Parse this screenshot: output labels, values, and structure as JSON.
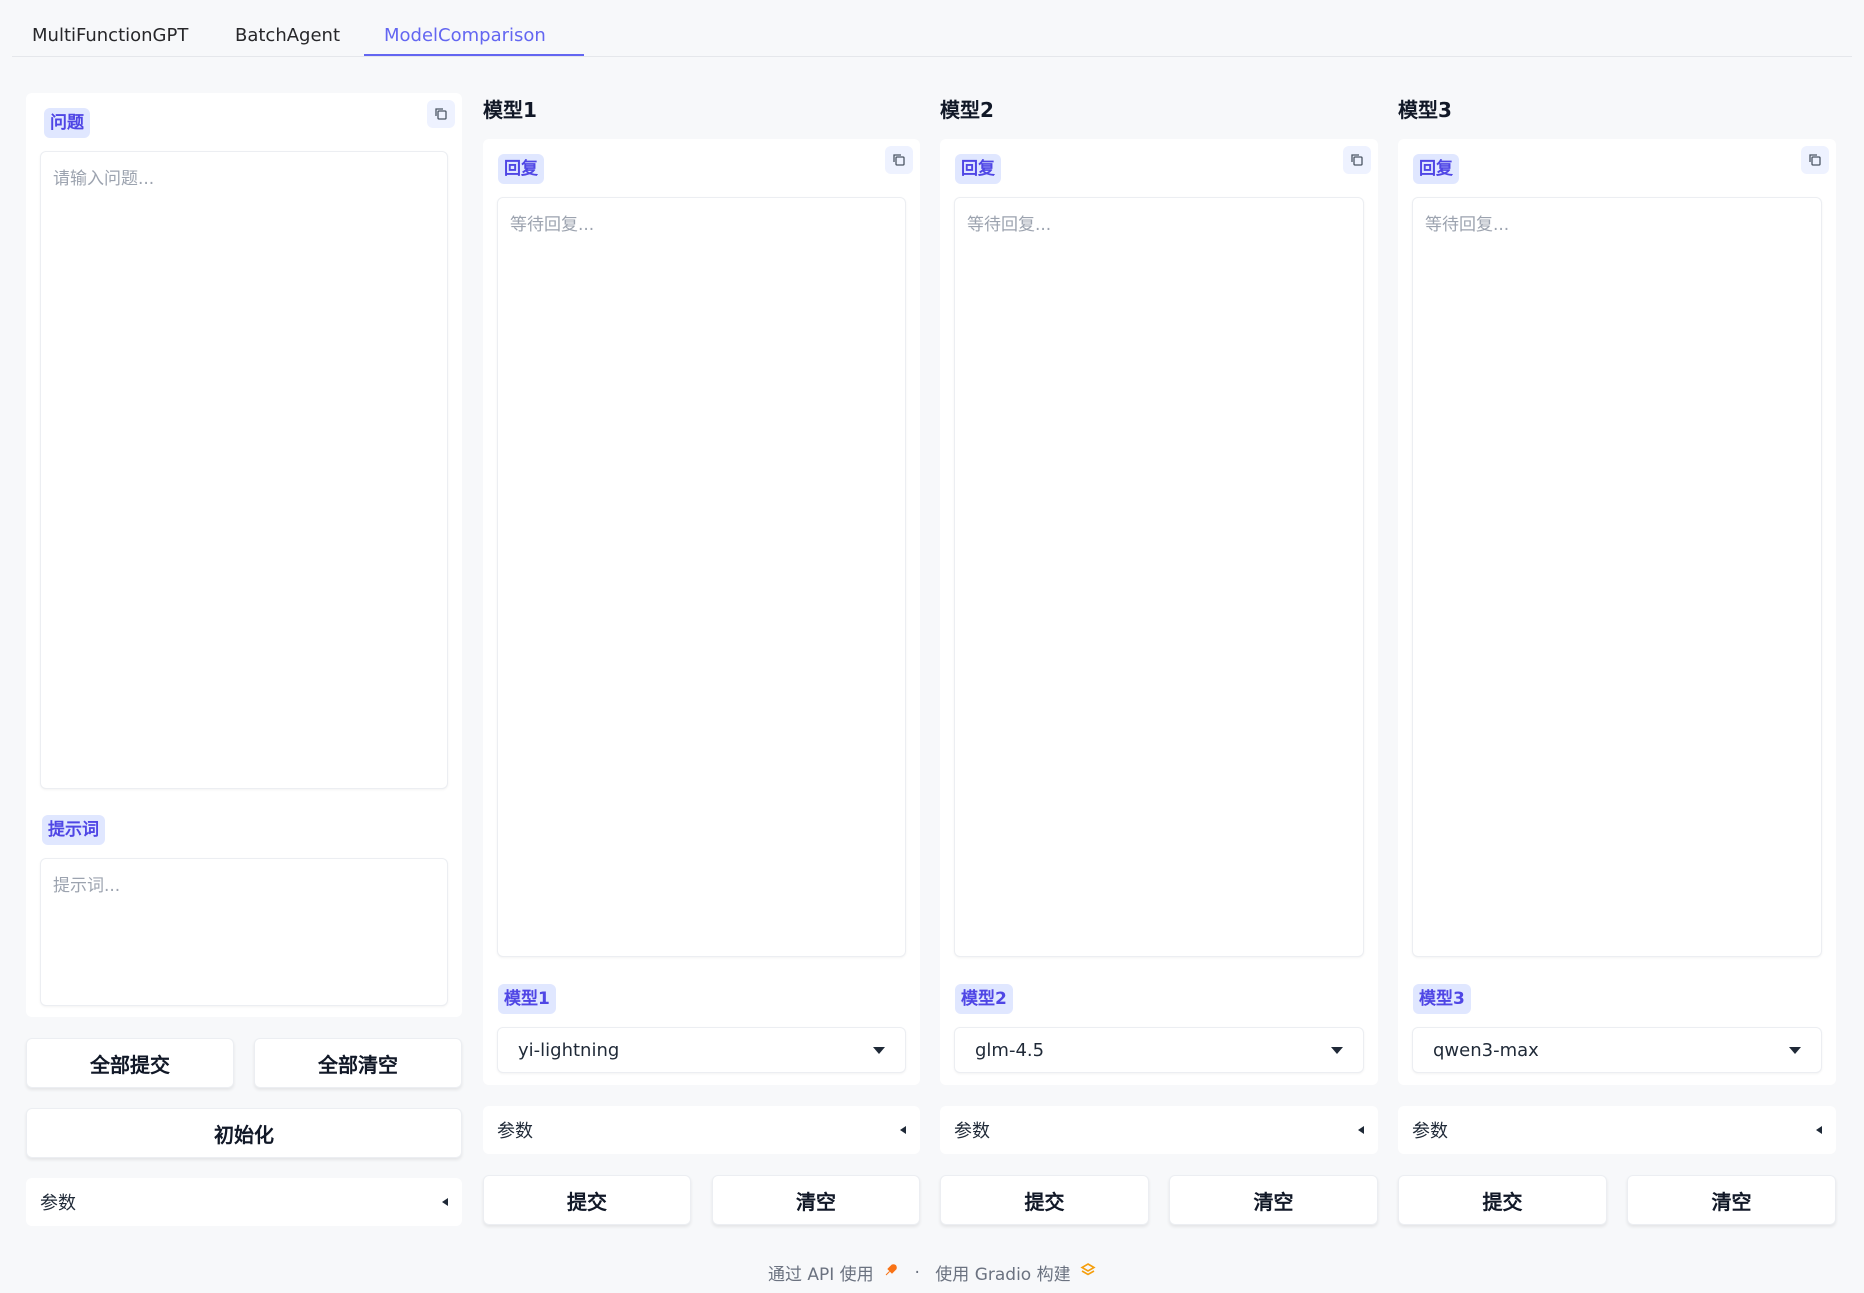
{
  "tabs": [
    {
      "label": "MultiFunctionGPT",
      "active": false
    },
    {
      "label": "BatchAgent",
      "active": false
    },
    {
      "label": "ModelComparison",
      "active": true
    }
  ],
  "left": {
    "question_label": "问题",
    "question_placeholder": "请输入问题...",
    "prompt_label": "提示词",
    "prompt_placeholder": "提示词...",
    "submit_all": "全部提交",
    "clear_all": "全部清空",
    "init": "初始化",
    "params": "参数"
  },
  "models": [
    {
      "title": "模型1",
      "reply_label": "回复",
      "reply_placeholder": "等待回复...",
      "select_label": "模型1",
      "selected": "yi-lightning",
      "params": "参数",
      "submit": "提交",
      "clear": "清空"
    },
    {
      "title": "模型2",
      "reply_label": "回复",
      "reply_placeholder": "等待回复...",
      "select_label": "模型2",
      "selected": "glm-4.5",
      "params": "参数",
      "submit": "提交",
      "clear": "清空"
    },
    {
      "title": "模型3",
      "reply_label": "回复",
      "reply_placeholder": "等待回复...",
      "select_label": "模型3",
      "selected": "qwen3-max",
      "params": "参数",
      "submit": "提交",
      "clear": "清空"
    }
  ],
  "footer": {
    "api_text": "通过 API 使用",
    "separator": "·",
    "gradio_text": "使用 Gradio 构建"
  },
  "colors": {
    "accent": "#6366f1",
    "badge_bg": "#e0e7ff",
    "page_bg": "#f7f8fa"
  }
}
